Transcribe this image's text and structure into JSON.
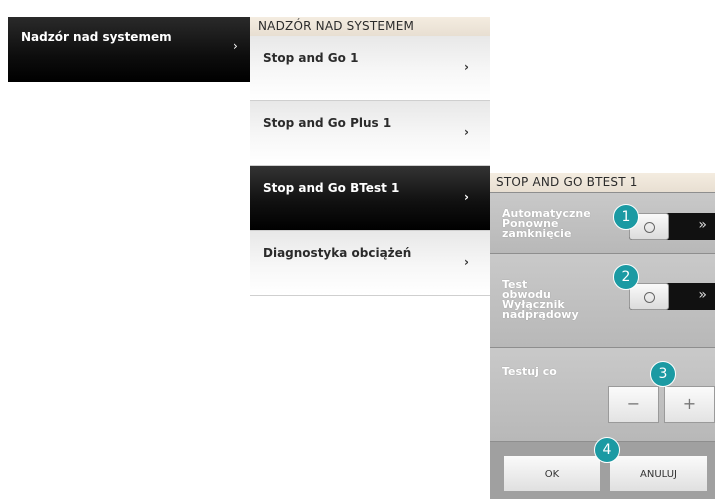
{
  "left_menu": {
    "item_label": "Nadzór nad systemem",
    "chevron": "›"
  },
  "middle_panel": {
    "header": "NADZÓR NAD SYSTEMEM",
    "items": [
      {
        "label": "Stop and Go 1",
        "chevron": "›"
      },
      {
        "label": "Stop and Go Plus 1",
        "chevron": "›"
      },
      {
        "label": "Stop and Go BTest 1",
        "chevron": "›",
        "active": true
      },
      {
        "label": "Diagnostyka obciążeń",
        "chevron": "›"
      }
    ]
  },
  "right_panel": {
    "header": "STOP AND GO BTEST 1",
    "auto_reclose": {
      "label_line1": "Automatyczne",
      "label_line2": "Ponowne",
      "label_line3": "zamknięcie",
      "state_icon": "○",
      "arrows_icon": "»"
    },
    "circuit_test": {
      "label_line1": "Test",
      "label_line2": "obwodu",
      "label_line3": "Wyłącznik",
      "label_line4": "nadprądowy",
      "state_icon": "○",
      "arrows_icon": "»"
    },
    "test_interval": {
      "label": "Testuj co",
      "minus": "−",
      "plus": "+"
    },
    "buttons": {
      "ok": "OK",
      "cancel": "ANULUJ"
    }
  },
  "badges": [
    "1",
    "2",
    "3",
    "4"
  ],
  "colors": {
    "badge": "#1b9aa3",
    "active_item": "#000000",
    "panel_bg": "#a5a5a5"
  }
}
